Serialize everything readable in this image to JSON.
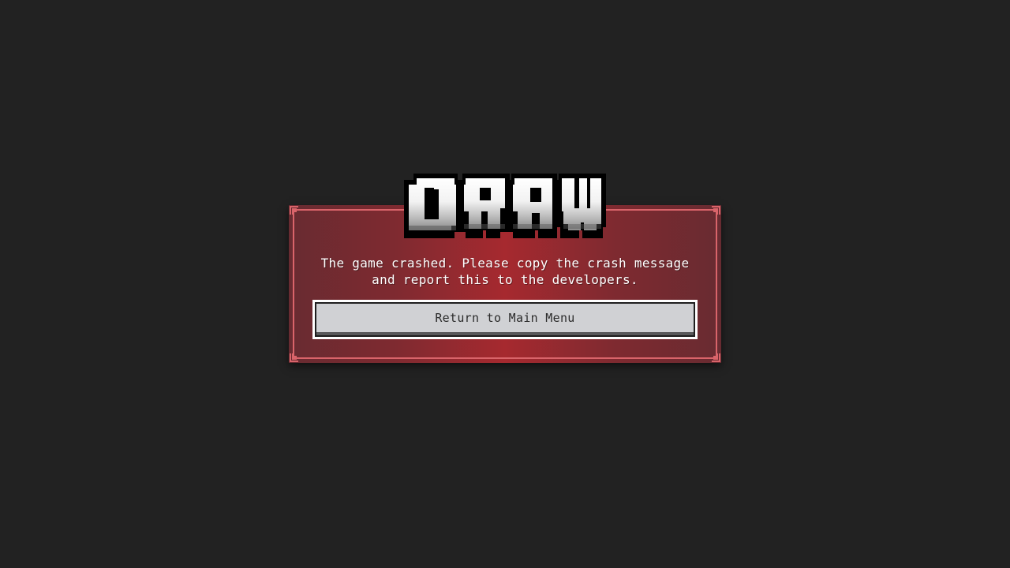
{
  "logo": {
    "text": "DRAW",
    "icon": "draw-logo"
  },
  "dialog": {
    "message_line1": "The game crashed. Please copy the crash message",
    "message_line2": "and report this to the developers.",
    "button_label": "Return to Main Menu"
  },
  "colors": {
    "background": "#222222",
    "panel_edge": "#682b31",
    "panel_center": "#a6292f",
    "frame": "#d9646a",
    "button_face": "#d0d1d4",
    "button_text": "#2b2b2b",
    "message_text": "#ffffff"
  }
}
